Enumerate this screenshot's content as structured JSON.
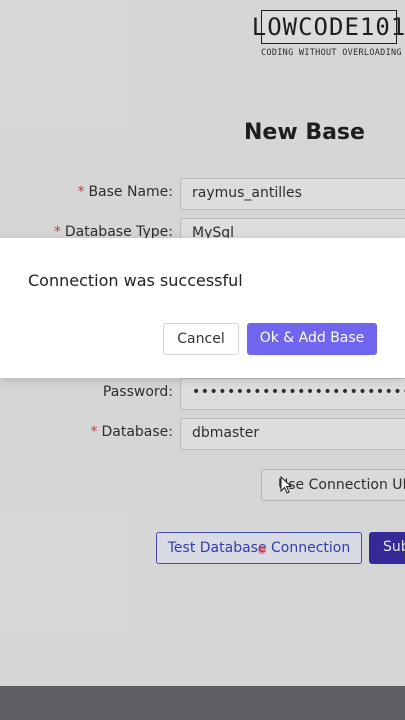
{
  "watermark": {
    "logo_text": "LOWCODE101",
    "tagline": "CODING WITHOUT OVERLOADING"
  },
  "form": {
    "title": "New Base",
    "fields": [
      {
        "label": "Base Name:",
        "required": true,
        "value": "raymus_antilles"
      },
      {
        "label": "Database Type:",
        "required": true,
        "value": "MySql"
      },
      {
        "label": "Password:",
        "required": false,
        "value": "••••••••••••••••••••••••••••••"
      },
      {
        "label": "Database:",
        "required": true,
        "value": "dbmaster"
      }
    ],
    "use_connection_url_label": "Use Connection URL",
    "test_connection_label": "Test Database Connection",
    "submit_label": "Submit"
  },
  "modal": {
    "message": "Connection was successful",
    "cancel_label": "Cancel",
    "ok_label": "Ok & Add Base"
  },
  "colors": {
    "primary": "#7065ee",
    "submit": "#3b2fa8",
    "test_border": "#4a55c7",
    "required": "#e0453c"
  }
}
